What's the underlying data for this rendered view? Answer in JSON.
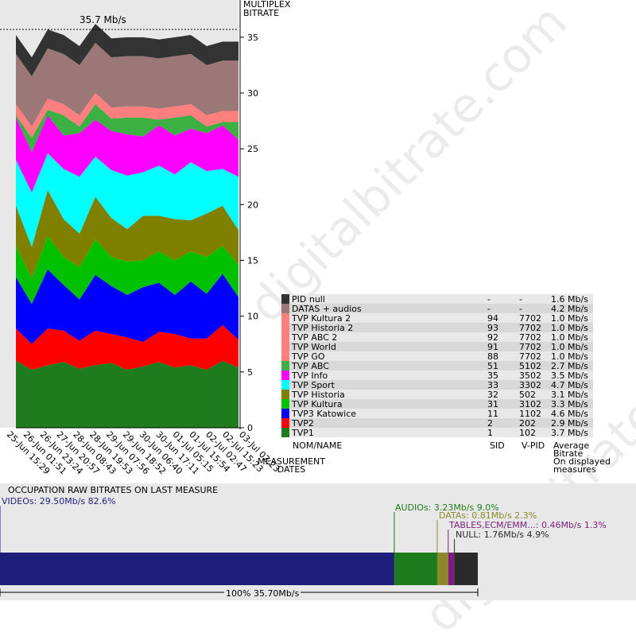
{
  "top_label": "35.7 Mb/s",
  "y_axis_title": "MULTIPLEX\nBITRATE",
  "x_axis_title": "MEASUREMENT\nDATES",
  "legend_headers": {
    "name": "NOM/NAME",
    "sid": "SID",
    "vpid": "V-PID",
    "bitrate": "Average\nBitrate\nOn displayed\nmeasures"
  },
  "legend": [
    {
      "name": "PID null",
      "sid": "-",
      "vpid": "-",
      "bitrate": "1.6 Mb/s",
      "color": "#333333"
    },
    {
      "name": "DATAS + audios",
      "sid": "-",
      "vpid": "-",
      "bitrate": "4.2 Mb/s",
      "color": "#9c7777"
    },
    {
      "name": "TVP Kultura 2",
      "sid": "94",
      "vpid": "7702",
      "bitrate": "1.0 Mb/s",
      "color": "#ff7f7f"
    },
    {
      "name": "TVP Historia 2",
      "sid": "93",
      "vpid": "7702",
      "bitrate": "1.0 Mb/s",
      "color": "#ff7f7f"
    },
    {
      "name": "TVP ABC 2",
      "sid": "92",
      "vpid": "7702",
      "bitrate": "1.0 Mb/s",
      "color": "#ff7f7f"
    },
    {
      "name": "TVP World",
      "sid": "91",
      "vpid": "7702",
      "bitrate": "1.0 Mb/s",
      "color": "#ff7f7f"
    },
    {
      "name": "TVP GO",
      "sid": "88",
      "vpid": "7702",
      "bitrate": "1.0 Mb/s",
      "color": "#ff7f7f"
    },
    {
      "name": "TVP ABC",
      "sid": "51",
      "vpid": "5102",
      "bitrate": "2.7 Mb/s",
      "color": "#3cb043"
    },
    {
      "name": "TVP Info",
      "sid": "35",
      "vpid": "3502",
      "bitrate": "3.5 Mb/s",
      "color": "#ff00ff"
    },
    {
      "name": "TVP Sport",
      "sid": "33",
      "vpid": "3302",
      "bitrate": "4.7 Mb/s",
      "color": "#00ffff"
    },
    {
      "name": "TVP Historia",
      "sid": "32",
      "vpid": "502",
      "bitrate": "3.1 Mb/s",
      "color": "#808000"
    },
    {
      "name": "TVP Kultura",
      "sid": "31",
      "vpid": "3102",
      "bitrate": "3.3 Mb/s",
      "color": "#00c000"
    },
    {
      "name": "TVP3 Katowice",
      "sid": "11",
      "vpid": "1102",
      "bitrate": "4.6 Mb/s",
      "color": "#0000ff"
    },
    {
      "name": "TVP2",
      "sid": "2",
      "vpid": "202",
      "bitrate": "2.9 Mb/s",
      "color": "#ff0000"
    },
    {
      "name": "TVP1",
      "sid": "1",
      "vpid": "102",
      "bitrate": "3.7 Mb/s",
      "color": "#1e7b1e"
    }
  ],
  "chart_data": {
    "type": "area",
    "ylim": [
      0,
      35.7
    ],
    "yticks": [
      0,
      5,
      10,
      15,
      20,
      25,
      30,
      35
    ],
    "x": [
      "25-Jun 15:29",
      "26-Jun 01:51",
      "26-Jun 23:24",
      "27-Jun 20:57",
      "28-Jun 08:43",
      "28-Jun 19:53",
      "29-Jun 07:56",
      "29-Jun 18:52",
      "30-Jun 06:40",
      "30-Jun 17:11",
      "01-Jul 05:15",
      "01-Jul 15:54",
      "02-Jul 02:47",
      "02-Jul 15:23",
      "03-Jul 02:23"
    ],
    "series": [
      {
        "name": "TVP1",
        "values": [
          6.0,
          5.2,
          5.6,
          5.9,
          5.3,
          5.6,
          5.8,
          5.2,
          5.5,
          5.9,
          5.4,
          5.6,
          5.2,
          6.0,
          5.4
        ]
      },
      {
        "name": "TVP2",
        "values": [
          2.9,
          2.3,
          3.3,
          2.8,
          2.5,
          3.1,
          2.6,
          2.9,
          2.2,
          2.7,
          3.0,
          2.4,
          2.8,
          3.2,
          2.5
        ]
      },
      {
        "name": "TVP3 Katowice",
        "values": [
          4.6,
          3.6,
          5.3,
          4.1,
          3.7,
          5.0,
          4.3,
          3.8,
          4.9,
          4.4,
          3.5,
          5.1,
          4.0,
          4.6,
          3.8
        ]
      },
      {
        "name": "TVP Kultura",
        "values": [
          2.8,
          2.3,
          3.0,
          2.5,
          2.9,
          3.2,
          2.6,
          3.0,
          2.4,
          2.8,
          3.1,
          2.7,
          3.3,
          2.5,
          2.9
        ]
      },
      {
        "name": "TVP Historia",
        "values": [
          3.6,
          2.8,
          4.1,
          3.4,
          3.0,
          3.8,
          3.5,
          2.9,
          4.0,
          3.2,
          3.7,
          2.8,
          3.9,
          3.6,
          3.1
        ]
      },
      {
        "name": "TVP Sport",
        "values": [
          4.1,
          4.9,
          3.3,
          4.5,
          5.1,
          3.6,
          4.3,
          4.8,
          3.9,
          4.5,
          4.0,
          5.2,
          3.8,
          3.3,
          4.8
        ]
      },
      {
        "name": "TVP Info",
        "values": [
          3.8,
          3.6,
          3.4,
          3.0,
          3.9,
          3.3,
          3.5,
          3.7,
          3.2,
          3.6,
          3.5,
          3.0,
          3.4,
          3.9,
          3.3
        ]
      },
      {
        "name": "TVP ABC",
        "values": [
          0.2,
          1.3,
          0.5,
          1.8,
          0.6,
          1.4,
          1.1,
          1.5,
          1.7,
          0.5,
          1.6,
          1.2,
          0.6,
          0.3,
          1.6
        ]
      },
      {
        "name": "TVP GO",
        "values": [
          1.0,
          1.0,
          1.0,
          1.0,
          1.0,
          1.0,
          1.0,
          1.0,
          1.0,
          1.0,
          1.0,
          1.0,
          1.0,
          1.0,
          1.0
        ]
      },
      {
        "name": "DATAS + audios",
        "values": [
          4.5,
          4.5,
          4.5,
          4.5,
          4.5,
          4.5,
          4.5,
          4.5,
          4.5,
          4.5,
          4.5,
          4.5,
          4.5,
          4.5,
          4.5
        ]
      },
      {
        "name": "PID null",
        "values": [
          1.7,
          1.7,
          1.7,
          1.7,
          1.7,
          1.7,
          1.7,
          1.7,
          1.7,
          1.7,
          1.7,
          1.7,
          1.7,
          1.7,
          1.7
        ]
      }
    ]
  },
  "occupation": {
    "title": "OCCUPATION RAW BITRATES ON LAST MEASURE",
    "total_label": "100%  35.70Mb/s",
    "segments": [
      {
        "label": "VIDEOs: 29.50Mb/s  82.6%",
        "fraction": 0.826,
        "color": "#1e1e7a",
        "text_color": "#1e1e7a"
      },
      {
        "label": "AUDIOs: 3.23Mb/s  9.0%",
        "fraction": 0.09,
        "color": "#1e7b1e",
        "text_color": "#1e7b1e"
      },
      {
        "label": "DATAs: 0.81Mb/s  2.3%",
        "fraction": 0.023,
        "color": "#8a8a2a",
        "text_color": "#8a8a2a"
      },
      {
        "label": "TABLES,ECM/EMM...: 0.46Mb/s  1.3%",
        "fraction": 0.013,
        "color": "#7a1e7a",
        "text_color": "#7a1e7a"
      },
      {
        "label": "NULL: 1.76Mb/s  4.9%",
        "fraction": 0.049,
        "color": "#2a2a2a",
        "text_color": "#2a2a2a"
      }
    ]
  },
  "watermark": "digitalbitrate.com"
}
